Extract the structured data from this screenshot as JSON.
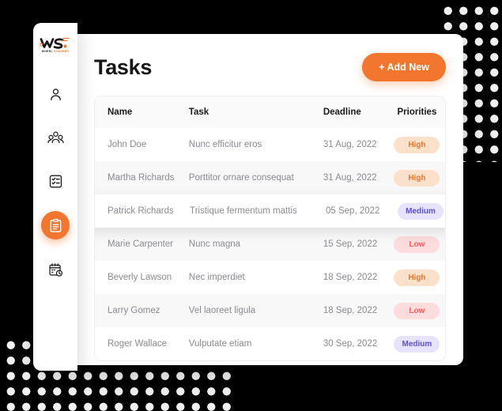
{
  "brand": {
    "logo_mark": "WS",
    "logo_sub_left": "WHEEL",
    "logo_sub_right": "SCANNER"
  },
  "sidebar": {
    "items": [
      {
        "icon": "user-icon",
        "name": "profile",
        "active": false
      },
      {
        "icon": "users-group-icon",
        "name": "team",
        "active": false
      },
      {
        "icon": "checklist-icon",
        "name": "lists",
        "active": false
      },
      {
        "icon": "clipboard-icon",
        "name": "tasks",
        "active": true
      },
      {
        "icon": "calendar-clock-icon",
        "name": "schedule",
        "active": false
      }
    ]
  },
  "header": {
    "title": "Tasks",
    "add_new_label": "+ Add New"
  },
  "table": {
    "columns": [
      "Name",
      "Task",
      "Deadline",
      "Priorities"
    ],
    "rows": [
      {
        "name": "John Doe",
        "task": "Nunc efficitur eros",
        "deadline": "31 Aug, 2022",
        "priority": "High",
        "priority_key": "high",
        "highlight": false
      },
      {
        "name": "Martha Richards",
        "task": "Porttitor ornare consequat",
        "deadline": "31 Aug, 2022",
        "priority": "High",
        "priority_key": "high",
        "highlight": false
      },
      {
        "name": "Patrick Richards",
        "task": "Tristique fermentum mattis",
        "deadline": "05 Sep, 2022",
        "priority": "Medium",
        "priority_key": "medium",
        "highlight": true
      },
      {
        "name": "Marie Carpenter",
        "task": "Nunc magna",
        "deadline": "15 Sep, 2022",
        "priority": "Low",
        "priority_key": "low",
        "highlight": false
      },
      {
        "name": "Beverly Lawson",
        "task": "Nec imperdiet",
        "deadline": "18 Sep, 2022",
        "priority": "High",
        "priority_key": "high",
        "highlight": false
      },
      {
        "name": "Larry Gomez",
        "task": "Vel laoreet ligula",
        "deadline": "18 Sep, 2022",
        "priority": "Low",
        "priority_key": "low",
        "highlight": false
      },
      {
        "name": "Roger Wallace",
        "task": "Vulputate etiam",
        "deadline": "30 Sep, 2022",
        "priority": "Medium",
        "priority_key": "medium",
        "highlight": false
      }
    ]
  },
  "colors": {
    "accent": "#F2762E",
    "high_bg": "#FBE0CA",
    "high_text": "#F2762E",
    "medium_bg": "#E8E3FD",
    "medium_text": "#5B4FE0",
    "low_bg": "#FCDCDC",
    "low_text": "#F4605F",
    "page_background": "#000000",
    "card_background": "#FFFFFF"
  }
}
